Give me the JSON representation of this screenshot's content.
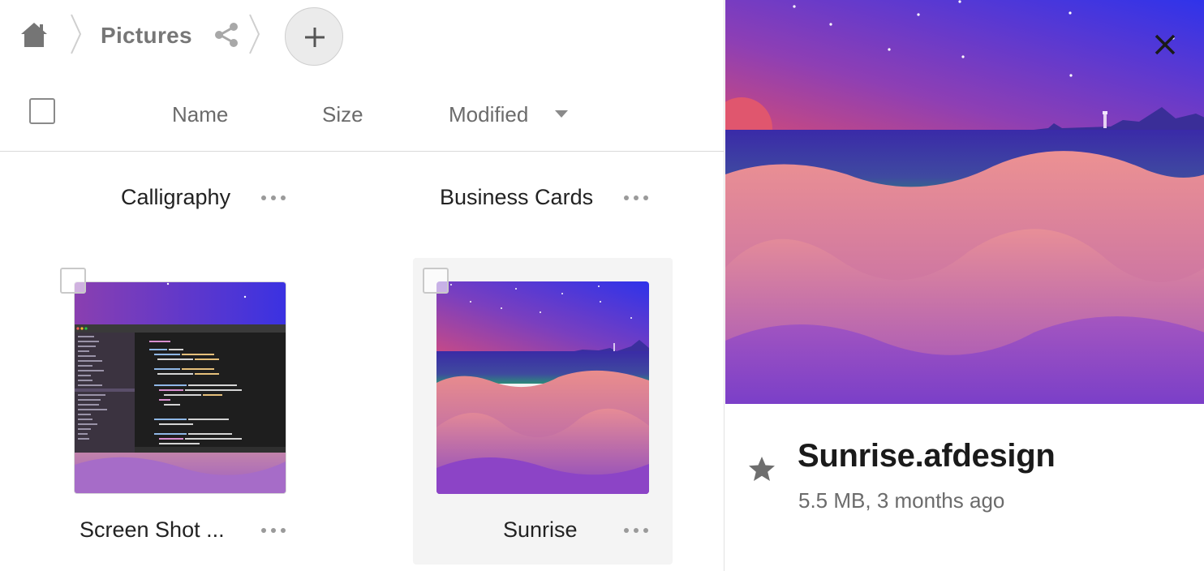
{
  "breadcrumb": {
    "home_icon": "home-icon",
    "current_folder": "Pictures",
    "share_icon": "share-icon",
    "add_icon": "plus-icon"
  },
  "columns": {
    "name": "Name",
    "size": "Size",
    "modified": "Modified",
    "sort_icon": "caret-down-icon"
  },
  "folders": [
    {
      "name": "Calligraphy"
    },
    {
      "name": "Business Cards"
    }
  ],
  "files": [
    {
      "name": "Screen Shot ...",
      "selected": false
    },
    {
      "name": "Sunrise",
      "selected": true
    }
  ],
  "preview": {
    "title": "Sunrise.afdesign",
    "meta": "5.5 MB, 3 months ago",
    "starred": false,
    "close_icon": "close-icon",
    "star_icon": "star-icon"
  },
  "colors": {
    "sky_top": "#3a2fe0",
    "sky_mid": "#7d3fb8",
    "sun": "#e0566e",
    "water": "#3c2aa8",
    "dune": "#e58a8f",
    "dune_dark": "#8a45b5",
    "code_bg": "#1e1e1e"
  }
}
